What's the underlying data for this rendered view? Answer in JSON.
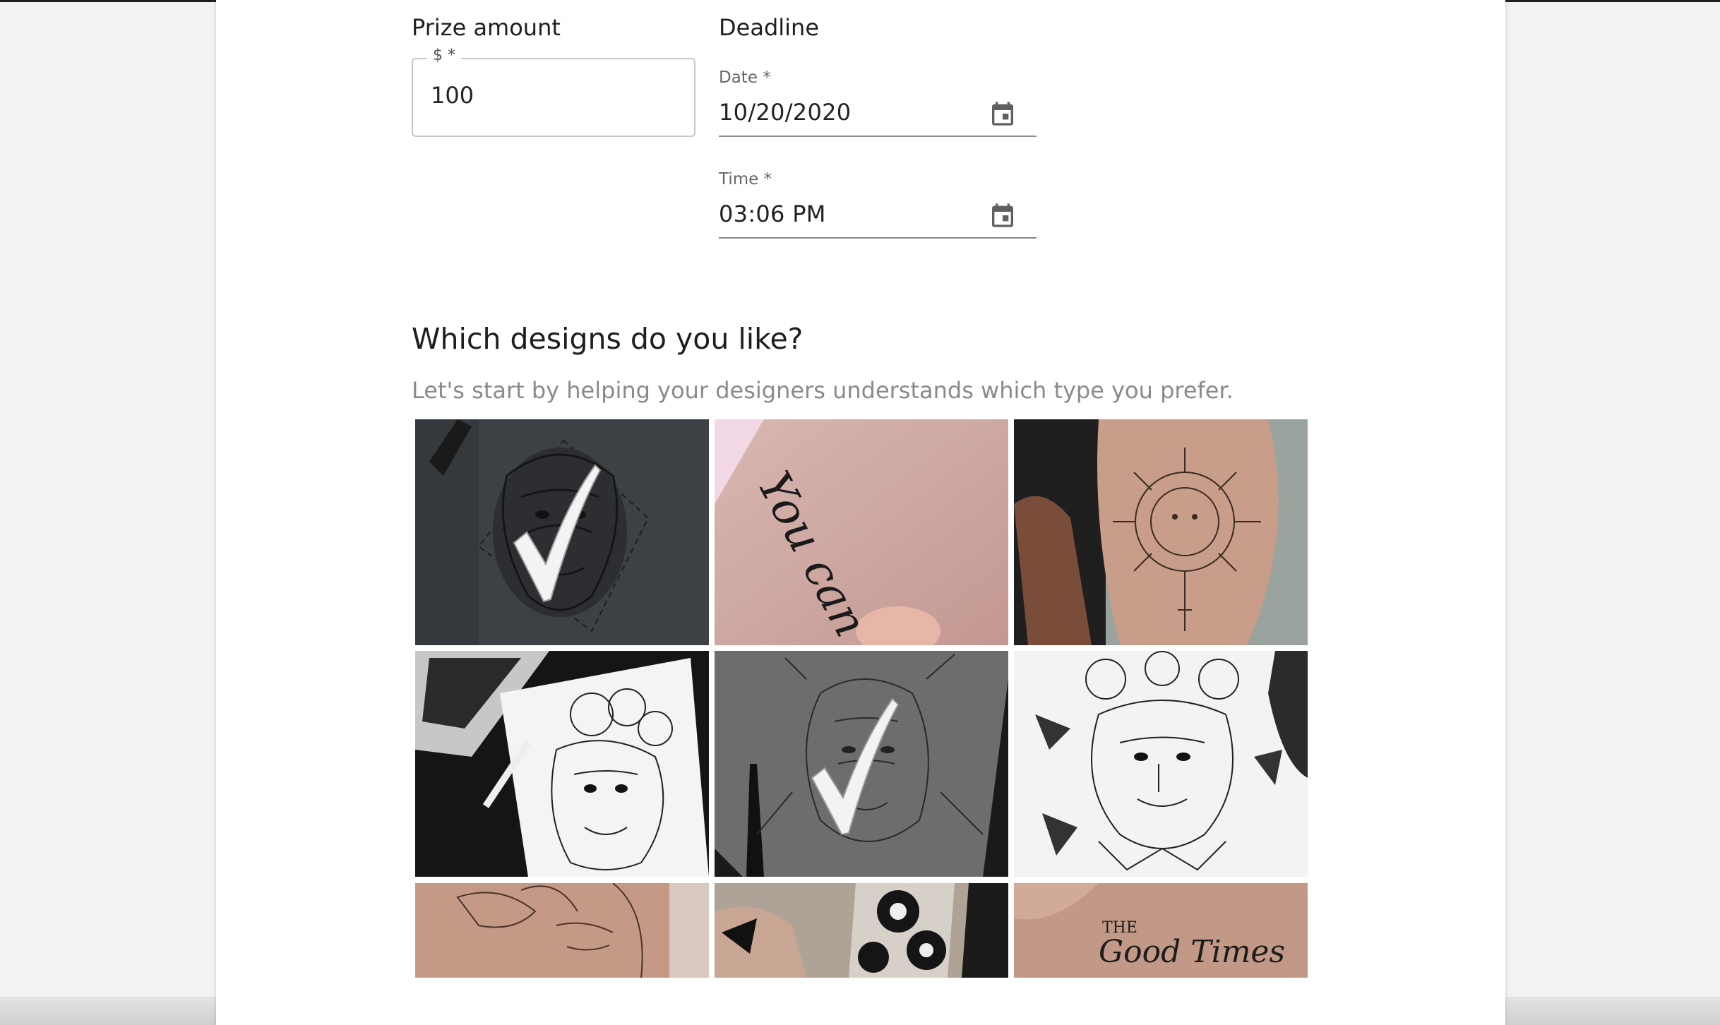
{
  "prize": {
    "title": "Prize amount",
    "legend": "$ *",
    "value": "100"
  },
  "deadline": {
    "title": "Deadline",
    "date_label": "Date *",
    "date_value": "10/20/2020",
    "time_label": "Time *",
    "time_value": "03:06 PM"
  },
  "designs": {
    "heading": "Which designs do you like?",
    "subtitle": "Let's start by helping your designers understands which type you prefer.",
    "tiles": [
      {
        "name": "geometric-lion",
        "selected": true
      },
      {
        "name": "you-can-script",
        "selected": false
      },
      {
        "name": "sun-moon-thigh",
        "selected": false
      },
      {
        "name": "floral-lion-sketch",
        "selected": false
      },
      {
        "name": "sketch-lion",
        "selected": true
      },
      {
        "name": "floral-tiger",
        "selected": false
      },
      {
        "name": "floral-face",
        "selected": false
      },
      {
        "name": "flower-sleeve",
        "selected": false
      },
      {
        "name": "good-times-script",
        "selected": false
      }
    ],
    "script_texts": {
      "you_can": "You can",
      "good_times_small": "THE",
      "good_times": "Good Times"
    }
  },
  "icons": {
    "calendar": "calendar-icon",
    "check": "check-icon"
  },
  "colors": {
    "card": "#ffffff",
    "page": "#f2f2f2",
    "text": "#1e1e1e",
    "muted": "#8a8a8a"
  }
}
